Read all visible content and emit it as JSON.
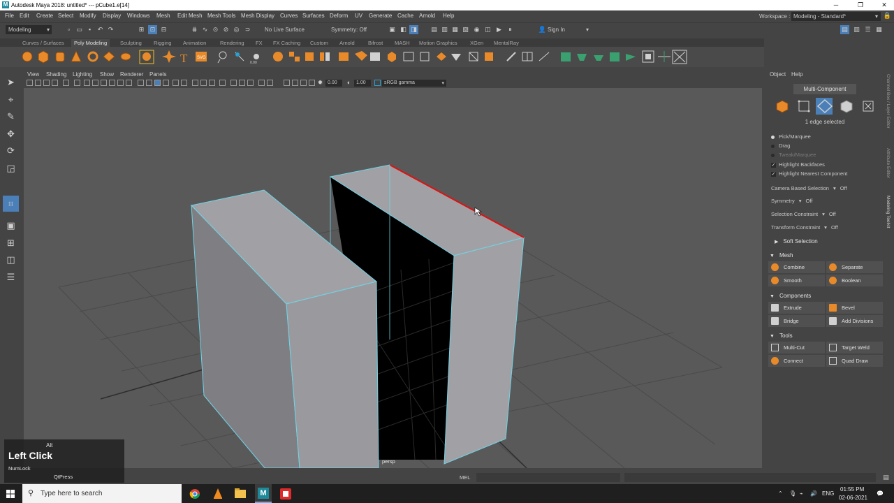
{
  "window": {
    "title": "Autodesk Maya 2018: untitled*   ---   pCube1.e[14]",
    "minimize_icon": "minimize-icon",
    "maximize_icon": "restore-icon",
    "close_icon": "close-icon"
  },
  "menubar": {
    "items": [
      "File",
      "Edit",
      "Create",
      "Select",
      "Modify",
      "Display",
      "Windows",
      "Mesh",
      "Edit Mesh",
      "Mesh Tools",
      "Mesh Display",
      "Curves",
      "Surfaces",
      "Deform",
      "UV",
      "Generate",
      "Cache",
      "Arnold",
      "Help"
    ],
    "workspace_label": "Workspace :",
    "workspace_value": "Modeling - Standard*"
  },
  "statusline": {
    "mode": "Modeling",
    "live_surface": "No Live Surface",
    "symmetry": "Symmetry: Off",
    "sign_in": "Sign In"
  },
  "shelf": {
    "tabs": [
      "Curves / Surfaces",
      "Poly Modeling",
      "Sculpting",
      "Rigging",
      "Animation",
      "Rendering",
      "FX",
      "FX Caching",
      "Custom",
      "Arnold",
      "Bifrost",
      "MASH",
      "Motion Graphics",
      "XGen",
      "MentalRay"
    ],
    "active_tab": "Poly Modeling"
  },
  "panel": {
    "menus": [
      "View",
      "Shading",
      "Lighting",
      "Show",
      "Renderer",
      "Panels"
    ],
    "exposure": "0.00",
    "gamma": "1.00",
    "color_space": "sRGB gamma",
    "camera": "persp"
  },
  "toolkit": {
    "tabs": [
      "Object",
      "Help"
    ],
    "mode": "Multi-Component",
    "selection_info": "1 edge selected",
    "pick_options": [
      {
        "label": "Pick/Marquee",
        "selected": true,
        "enabled": true
      },
      {
        "label": "Drag",
        "selected": false,
        "enabled": true
      },
      {
        "label": "Tweak/Marquee",
        "selected": false,
        "enabled": false
      }
    ],
    "checks": [
      "Highlight Backfaces",
      "Highlight Nearest Component"
    ],
    "settings": [
      {
        "label": "Camera Based Selection",
        "value": "Off"
      },
      {
        "label": "Symmetry",
        "value": "Off"
      },
      {
        "label": "Selection Constraint",
        "value": "Off"
      },
      {
        "label": "Transform Constraint",
        "value": "Off"
      }
    ],
    "soft_selection": "Soft Selection",
    "sections": {
      "mesh": {
        "title": "Mesh",
        "buttons": [
          "Combine",
          "Separate",
          "Smooth",
          "Boolean"
        ]
      },
      "components": {
        "title": "Components",
        "buttons": [
          "Extrude",
          "Bevel",
          "Bridge",
          "Add Divisions"
        ]
      },
      "tools": {
        "title": "Tools",
        "buttons": [
          "Multi-Cut",
          "Target Weld",
          "Connect",
          "Quad Draw"
        ]
      }
    }
  },
  "side_tabs": [
    "Channel Box / Layer Editor",
    "Attribute Editor",
    "Modeling Toolkit"
  ],
  "cmdline": {
    "label": "MEL"
  },
  "key_overlay": {
    "modifier": "Alt",
    "action": "Left Click",
    "numlock": "NumLock",
    "app": "QtPress"
  },
  "taskbar": {
    "search_placeholder": "Type here to search",
    "language": "ENG",
    "time": "01:55 PM",
    "date": "02-06-2021"
  },
  "colors": {
    "selected_edge": "#e01010",
    "wire": "#6fd4e8",
    "accent_blue": "#4b7fb8",
    "shelf_orange": "#e88a2a"
  }
}
